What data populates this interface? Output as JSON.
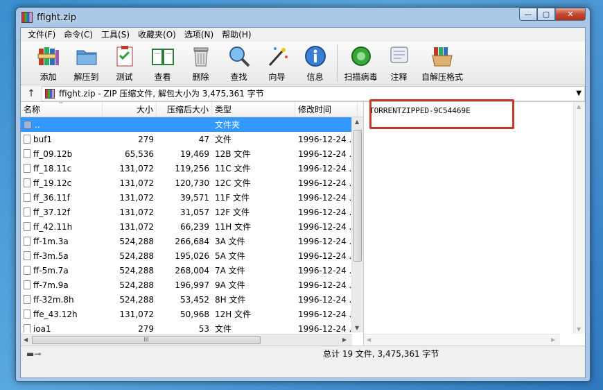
{
  "window": {
    "title": "ffight.zip",
    "buttons": {
      "minimize": "—",
      "maximize": "▢",
      "close": "✕"
    }
  },
  "menubar": [
    "文件(F)",
    "命令(C)",
    "工具(S)",
    "收藏夹(O)",
    "选项(N)",
    "帮助(H)"
  ],
  "toolbar": {
    "add": "添加",
    "extract_to": "解压到",
    "test": "测试",
    "view": "查看",
    "delete": "删除",
    "find": "查找",
    "wizard": "向导",
    "info": "信息",
    "virus_scan": "扫描病毒",
    "comment": "注释",
    "sfx": "自解压格式"
  },
  "address": {
    "up_arrow": "↑",
    "path": "ffight.zip - ZIP 压缩文件, 解包大小为 3,475,361 字节",
    "dropdown": "▼"
  },
  "columns": {
    "name": "名称",
    "size": "大小",
    "packed": "压缩后大小",
    "type": "类型",
    "modified": "修改时间"
  },
  "files": [
    {
      "name": "..",
      "size": "",
      "packed": "",
      "type": "文件夹",
      "modified": ""
    },
    {
      "name": "buf1",
      "size": "279",
      "packed": "47",
      "type": "文件",
      "modified": "1996-12-24 ..."
    },
    {
      "name": "ff_09.12b",
      "size": "65,536",
      "packed": "19,469",
      "type": "12B 文件",
      "modified": "1996-12-24 ..."
    },
    {
      "name": "ff_18.11c",
      "size": "131,072",
      "packed": "119,256",
      "type": "11C 文件",
      "modified": "1996-12-24 ..."
    },
    {
      "name": "ff_19.12c",
      "size": "131,072",
      "packed": "120,730",
      "type": "12C 文件",
      "modified": "1996-12-24 ..."
    },
    {
      "name": "ff_36.11f",
      "size": "131,072",
      "packed": "39,571",
      "type": "11F 文件",
      "modified": "1996-12-24 ..."
    },
    {
      "name": "ff_37.12f",
      "size": "131,072",
      "packed": "31,057",
      "type": "12F 文件",
      "modified": "1996-12-24 ..."
    },
    {
      "name": "ff_42.11h",
      "size": "131,072",
      "packed": "66,239",
      "type": "11H 文件",
      "modified": "1996-12-24 ..."
    },
    {
      "name": "ff-1m.3a",
      "size": "524,288",
      "packed": "266,684",
      "type": "3A 文件",
      "modified": "1996-12-24 ..."
    },
    {
      "name": "ff-3m.5a",
      "size": "524,288",
      "packed": "195,026",
      "type": "5A 文件",
      "modified": "1996-12-24 ..."
    },
    {
      "name": "ff-5m.7a",
      "size": "524,288",
      "packed": "268,004",
      "type": "7A 文件",
      "modified": "1996-12-24 ..."
    },
    {
      "name": "ff-7m.9a",
      "size": "524,288",
      "packed": "196,997",
      "type": "9A 文件",
      "modified": "1996-12-24 ..."
    },
    {
      "name": "ff-32m.8h",
      "size": "524,288",
      "packed": "53,452",
      "type": "8H 文件",
      "modified": "1996-12-24 ..."
    },
    {
      "name": "ffe_43.12h",
      "size": "131,072",
      "packed": "50,968",
      "type": "12H 文件",
      "modified": "1996-12-24 ..."
    },
    {
      "name": "ioa1",
      "size": "279",
      "packed": "53",
      "type": "文件",
      "modified": "1996-12-24 ..."
    }
  ],
  "comment": "TORRENTZIPPED-9C54469E",
  "status": {
    "summary": "总计 19 文件, 3,475,361 字节"
  },
  "colors": {
    "selection": "#3399ff",
    "highlight_box": "#c0392b",
    "title_bar": "#a9c7e6"
  }
}
